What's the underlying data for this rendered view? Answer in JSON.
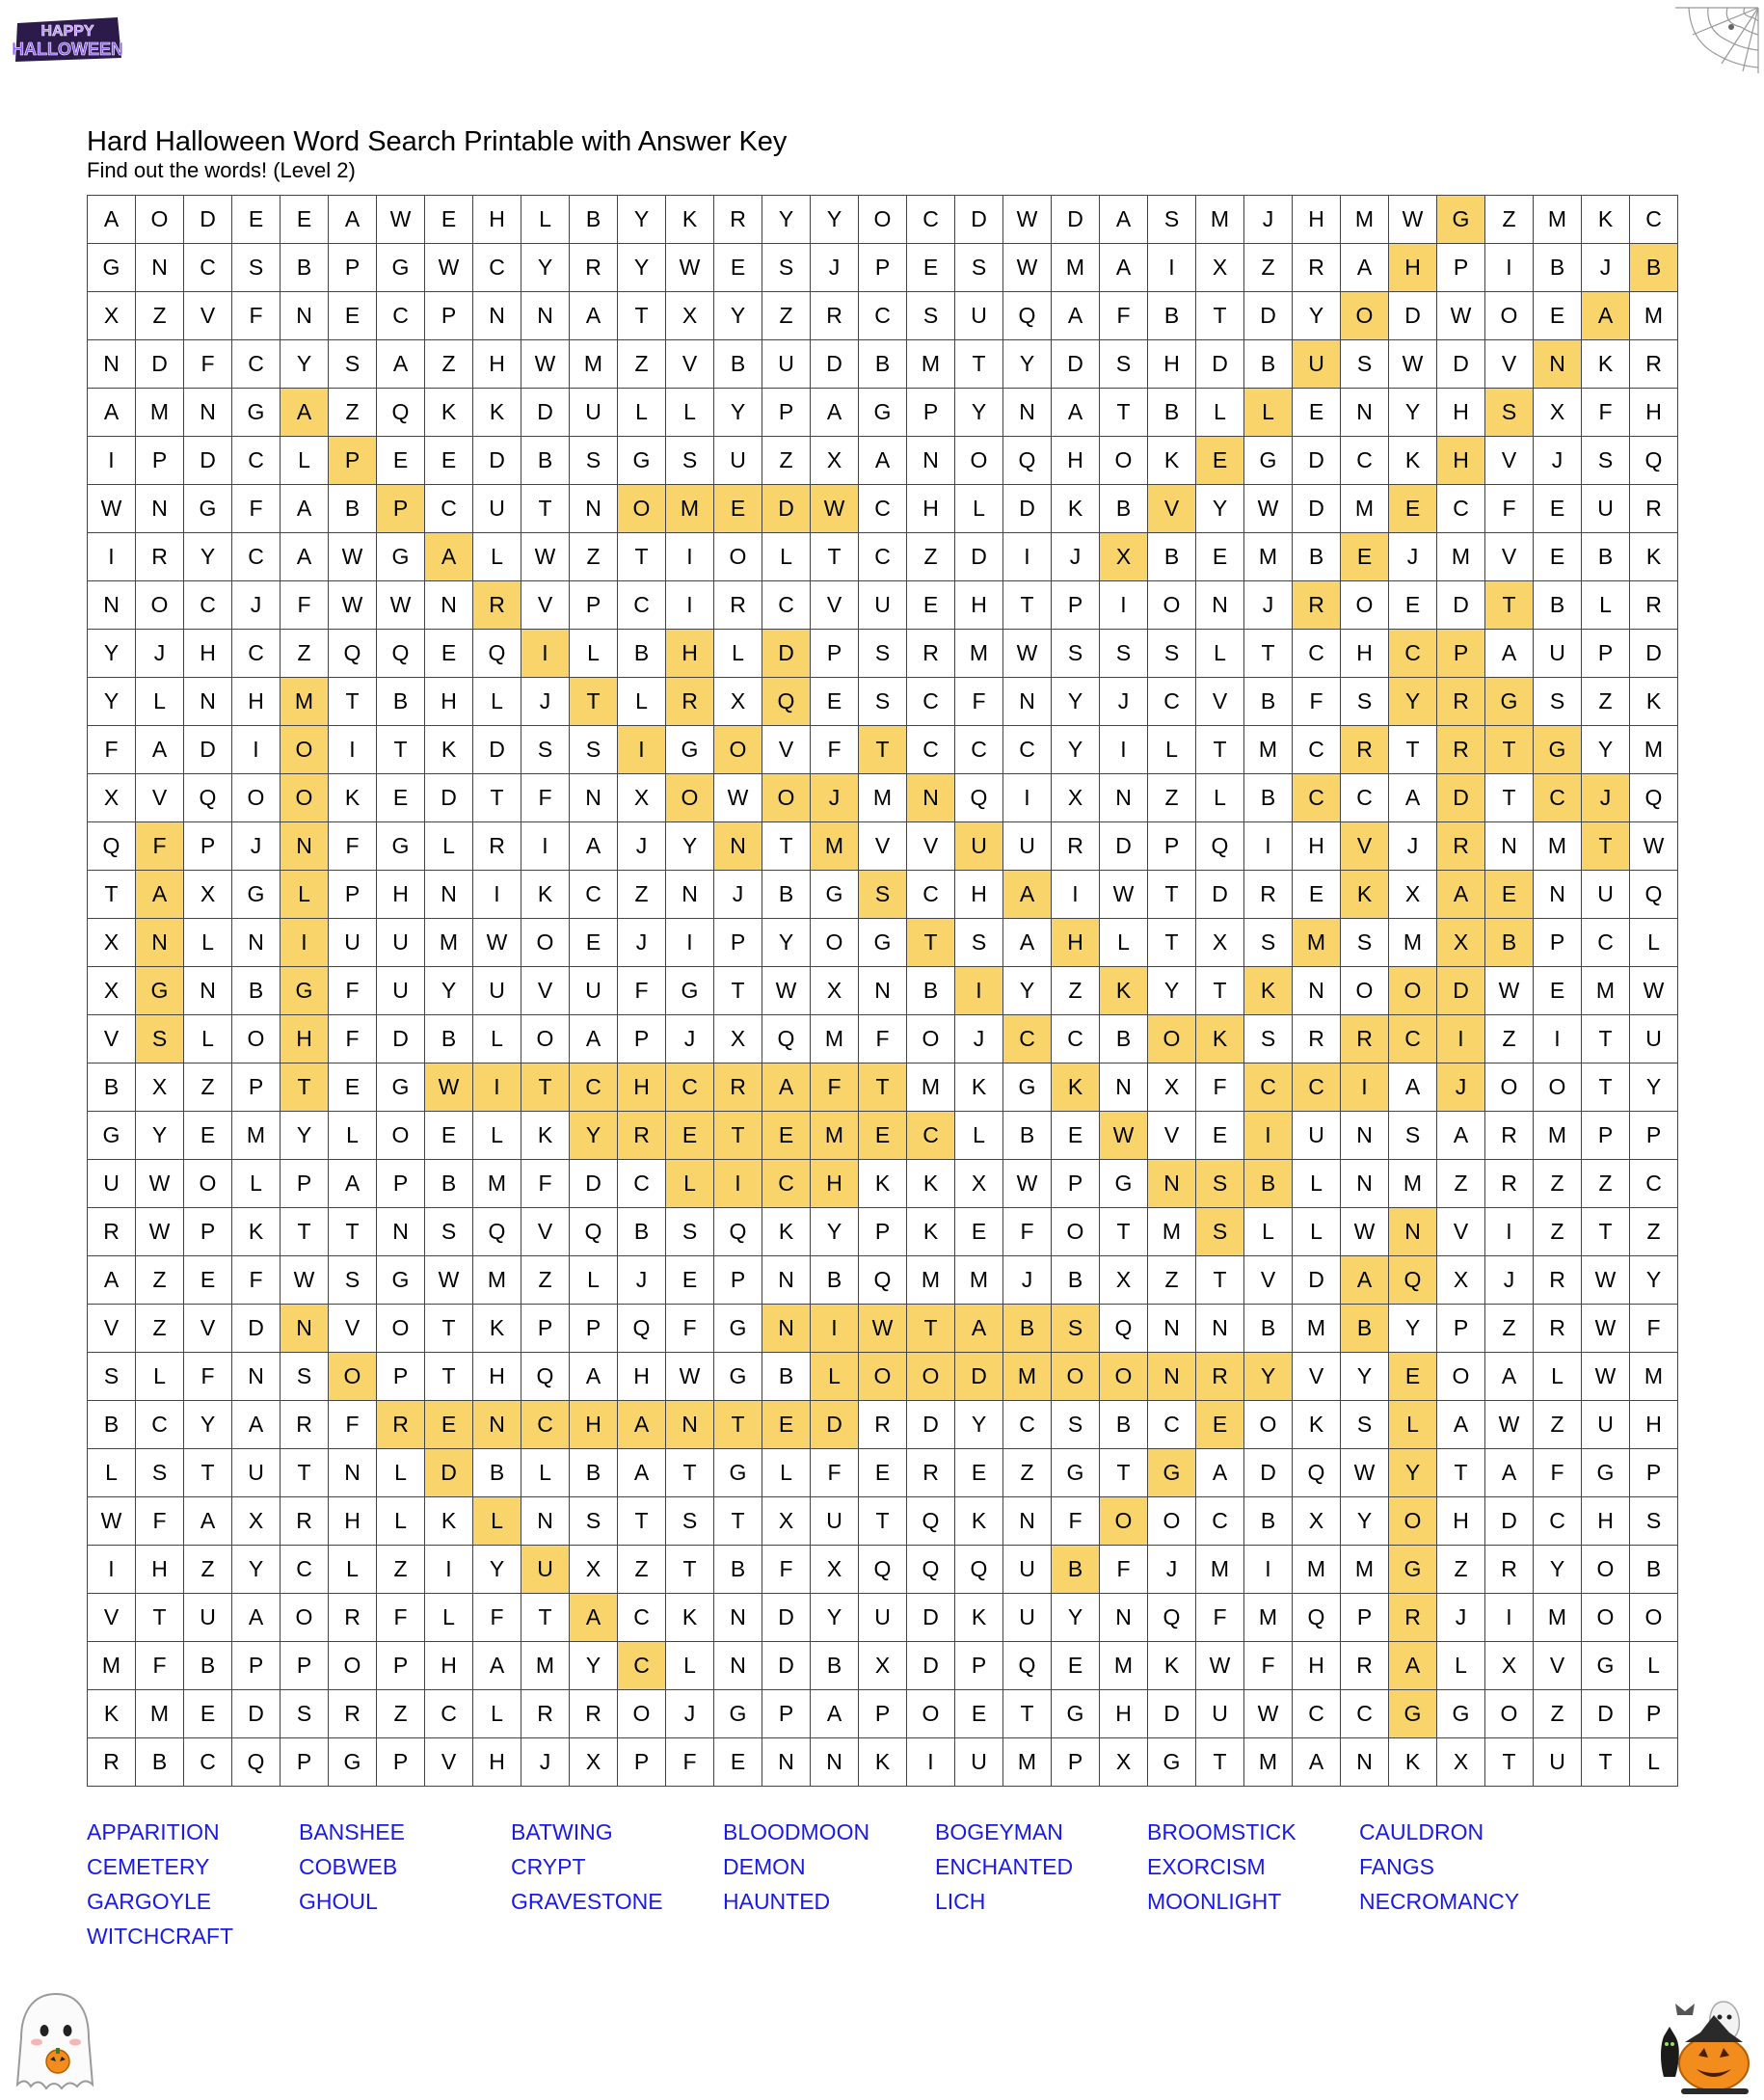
{
  "header": {
    "logo_text": "HAPPY HALLOWEEN",
    "title": "Hard Halloween Word Search Printable with Answer Key",
    "subtitle": "Find out the words! (Level 2)"
  },
  "colors": {
    "highlight": "#f9d46b",
    "word_link": "#1a1ae6",
    "grid_line": "#444444"
  },
  "grid": {
    "rows": [
      "AODEEAWEHLBYKRYYOCDWDASMJHMWGZMKC",
      "GNCSBPGWCYRYWESJPESWMAIXZRAHPIBJB",
      "XZVFNECPNNATXYZRCSUQAFBTDYODWOEAM",
      "NDFCYSAZHWMZVBUDBMTYDSHDBUSWDVNKR",
      "AMNGAZQKKDULLYPAGPYNATBLLENYHSXFH",
      "IPDCLPEEDBSGSUZXANOQHOKEGDCKHVJSQ",
      "WNGFABPCUTNOMEDWCHLDKBVYWDMECFEUR",
      "IRYCAWGALWZTIOLTCZDIJXBEMBEJMVEBK",
      "NOCJFWWNRVPCIRCVUEHTPIONJROEDTBLR",
      "YJHCZQQEQILBHLDPSRMWSSSLTCHCPAUPD",
      "YLNHMTBHLJTLRXQESCFNYJCVBFSYRGSZK",
      "FADIOITKDSSIGOVFTCCCYILTMCRTRTGYM",
      "XVQOOKEDTFNXOWOJMNQIXNZLBCCADTCJQ",
      "QFPJNFGLRIAJYNTMVVUURDPQIHVJRNMTW",
      "TAXGLPHNIKCZNJBGSCHAIWTDREKXAENUQ",
      "XNLNIUUMWOEJIPYOGTSAHLTXSMSMXBPCL",
      "XGNBGFUYUVUFGTWXNBIYZKYTKNOODWEMW",
      "VSLOHFDBLOAPJXQMFOJCCBOKSRRCIZITU",
      "BXZPTEGWITCHCRAFTMKGKNXFCCIAJOOTY",
      "GYEMYLOELKYRETEMECLBEWVEIUNSARMPP",
      "UWOLPAPBMFDCLICHKKXWPGNSBLNMZRZZC",
      "RWPKTTNSQVQBSQKYPKEFOTMSLLWNVIZTZ",
      "AZEFWSGWMZLJEPNBQMMJBXZTVDAQXJRWY",
      "VZVDNVOTKPPQFGNIWTABSQNNBMBYPZRWF",
      "SLFNSOPTHQAHWGBLOODMOONRYVYEOALWM",
      "BCYARFRENCHANTEDRDYCSBCEOKSLAWZUH",
      "LSTUTNLDBLBATGLFEREZGTGADQWYTAFGP",
      "WFAXRHLKLNSTSTXUTQKNFOOCBXYOHDCHS",
      "IHZYCLZIYUXZTBFXQQQUBFJMIMMGZRYOB",
      "VTUAORFLFTACKNDYUDKUYNQFMQPRJIMOO",
      "MFBPPOPHAMYCLNDBXDPQEMKWFHRALXVGL",
      "KMEDSRZCLRROJGPAPOETGHDUWCCGGOZDP",
      "RBCQPGPVHJXPFENNKIUMPXGTMANKXTUTL"
    ],
    "highlights": [
      [
        0,
        28
      ],
      [
        1,
        27
      ],
      [
        2,
        26
      ],
      [
        3,
        25
      ],
      [
        4,
        24
      ],
      [
        5,
        23
      ],
      [
        6,
        22
      ],
      [
        7,
        21
      ],
      [
        1,
        32
      ],
      [
        2,
        31
      ],
      [
        3,
        30
      ],
      [
        4,
        29
      ],
      [
        5,
        28
      ],
      [
        6,
        27
      ],
      [
        7,
        26
      ],
      [
        8,
        25
      ],
      [
        4,
        4
      ],
      [
        5,
        5
      ],
      [
        6,
        6
      ],
      [
        7,
        7
      ],
      [
        8,
        8
      ],
      [
        9,
        9
      ],
      [
        10,
        10
      ],
      [
        11,
        11
      ],
      [
        12,
        12
      ],
      [
        13,
        13
      ],
      [
        6,
        11
      ],
      [
        6,
        12
      ],
      [
        6,
        13
      ],
      [
        6,
        14
      ],
      [
        6,
        15
      ],
      [
        9,
        12
      ],
      [
        10,
        12
      ],
      [
        9,
        14
      ],
      [
        10,
        14
      ],
      [
        11,
        13
      ],
      [
        12,
        14
      ],
      [
        8,
        29
      ],
      [
        9,
        28
      ],
      [
        10,
        27
      ],
      [
        11,
        26
      ],
      [
        12,
        25
      ],
      [
        9,
        27
      ],
      [
        10,
        28
      ],
      [
        11,
        29
      ],
      [
        12,
        30
      ],
      [
        13,
        31
      ],
      [
        10,
        4
      ],
      [
        11,
        4
      ],
      [
        12,
        4
      ],
      [
        13,
        4
      ],
      [
        14,
        4
      ],
      [
        15,
        4
      ],
      [
        16,
        4
      ],
      [
        17,
        4
      ],
      [
        18,
        4
      ],
      [
        10,
        29
      ],
      [
        11,
        30
      ],
      [
        12,
        31
      ],
      [
        11,
        16
      ],
      [
        12,
        17
      ],
      [
        13,
        18
      ],
      [
        14,
        19
      ],
      [
        15,
        20
      ],
      [
        16,
        21
      ],
      [
        17,
        22
      ],
      [
        11,
        28
      ],
      [
        12,
        28
      ],
      [
        13,
        28
      ],
      [
        14,
        28
      ],
      [
        15,
        28
      ],
      [
        16,
        28
      ],
      [
        17,
        28
      ],
      [
        18,
        28
      ],
      [
        12,
        15
      ],
      [
        13,
        15
      ],
      [
        14,
        16
      ],
      [
        15,
        17
      ],
      [
        16,
        18
      ],
      [
        17,
        19
      ],
      [
        18,
        20
      ],
      [
        19,
        21
      ],
      [
        20,
        22
      ],
      [
        13,
        1
      ],
      [
        14,
        1
      ],
      [
        15,
        1
      ],
      [
        16,
        1
      ],
      [
        17,
        1
      ],
      [
        13,
        26
      ],
      [
        14,
        26
      ],
      [
        15,
        25
      ],
      [
        16,
        24
      ],
      [
        17,
        23
      ],
      [
        18,
        24
      ],
      [
        19,
        24
      ],
      [
        20,
        23
      ],
      [
        20,
        24
      ],
      [
        14,
        29
      ],
      [
        15,
        29
      ],
      [
        16,
        28
      ],
      [
        16,
        27
      ],
      [
        17,
        27
      ],
      [
        17,
        26
      ],
      [
        18,
        26
      ],
      [
        18,
        25
      ],
      [
        18,
        7
      ],
      [
        18,
        8
      ],
      [
        18,
        9
      ],
      [
        18,
        10
      ],
      [
        18,
        11
      ],
      [
        18,
        12
      ],
      [
        18,
        13
      ],
      [
        18,
        14
      ],
      [
        18,
        15
      ],
      [
        18,
        16
      ],
      [
        19,
        10
      ],
      [
        19,
        11
      ],
      [
        19,
        12
      ],
      [
        19,
        13
      ],
      [
        19,
        14
      ],
      [
        19,
        15
      ],
      [
        19,
        16
      ],
      [
        19,
        17
      ],
      [
        20,
        12
      ],
      [
        20,
        13
      ],
      [
        20,
        14
      ],
      [
        20,
        15
      ],
      [
        21,
        23
      ],
      [
        22,
        26
      ],
      [
        23,
        26
      ],
      [
        21,
        27
      ],
      [
        22,
        27
      ],
      [
        24,
        27
      ],
      [
        25,
        27
      ],
      [
        23,
        14
      ],
      [
        23,
        15
      ],
      [
        23,
        16
      ],
      [
        23,
        17
      ],
      [
        23,
        18
      ],
      [
        23,
        19
      ],
      [
        23,
        20
      ],
      [
        24,
        15
      ],
      [
        24,
        16
      ],
      [
        24,
        17
      ],
      [
        24,
        18
      ],
      [
        24,
        19
      ],
      [
        24,
        20
      ],
      [
        24,
        21
      ],
      [
        24,
        22
      ],
      [
        24,
        23
      ],
      [
        24,
        24
      ],
      [
        23,
        4
      ],
      [
        24,
        5
      ],
      [
        25,
        6
      ],
      [
        25,
        7
      ],
      [
        25,
        8
      ],
      [
        25,
        9
      ],
      [
        25,
        10
      ],
      [
        25,
        11
      ],
      [
        25,
        12
      ],
      [
        25,
        13
      ],
      [
        25,
        14
      ],
      [
        25,
        15
      ],
      [
        25,
        23
      ],
      [
        26,
        22
      ],
      [
        27,
        21
      ],
      [
        28,
        20
      ],
      [
        26,
        27
      ],
      [
        27,
        27
      ],
      [
        28,
        27
      ],
      [
        29,
        27
      ],
      [
        30,
        27
      ],
      [
        31,
        27
      ],
      [
        26,
        7
      ],
      [
        27,
        8
      ],
      [
        28,
        9
      ],
      [
        29,
        10
      ],
      [
        30,
        11
      ]
    ]
  },
  "word_list": [
    "APPARITION",
    "BANSHEE",
    "BATWING",
    "BLOODMOON",
    "BOGEYMAN",
    "BROOMSTICK",
    "CAULDRON",
    "CEMETERY",
    "COBWEB",
    "CRYPT",
    "DEMON",
    "ENCHANTED",
    "EXORCISM",
    "FANGS",
    "GARGOYLE",
    "GHOUL",
    "GRAVESTONE",
    "HAUNTED",
    "LICH",
    "MOONLIGHT",
    "NECROMANCY",
    "WITCHCRAFT"
  ]
}
